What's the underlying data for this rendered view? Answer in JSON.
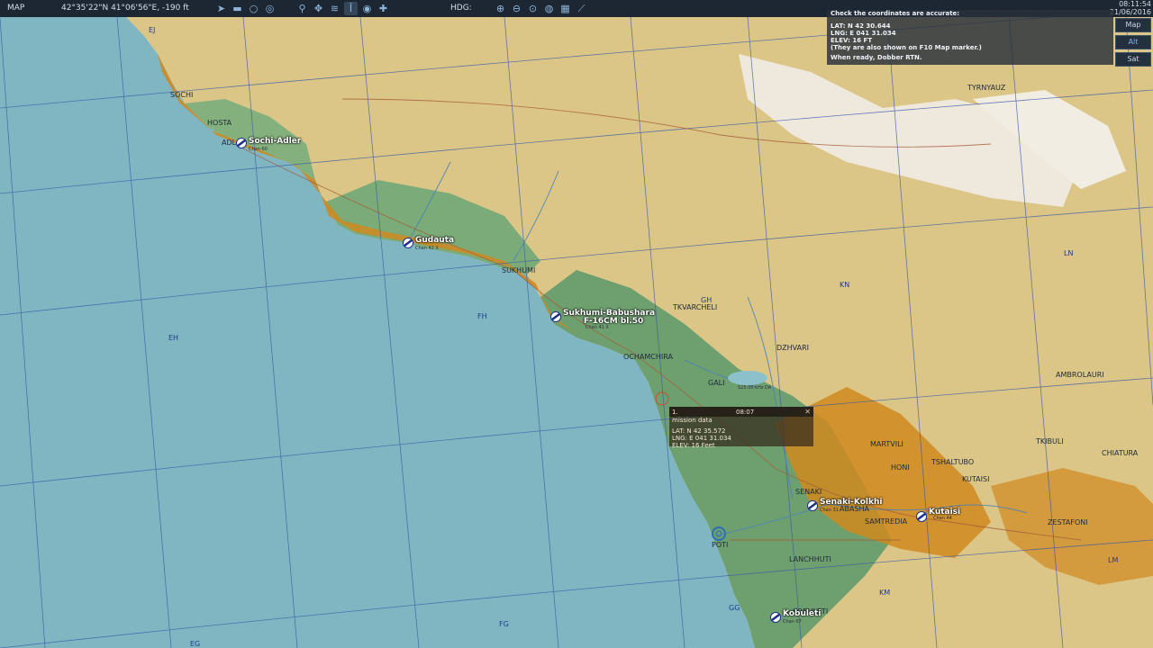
{
  "topbar": {
    "mode_label": "MAP",
    "cursor_readout": "42°35'22\"N 41°06'56\"E, -190 ft",
    "hdg_label": "HDG:",
    "clock_time": "08:11:54",
    "clock_date": "21/06/2016",
    "tool_icons": [
      "flight-plan-icon",
      "vehicle-icon",
      "circle-draw-icon",
      "chat-icon",
      "network-icon",
      "target-icon",
      "wireless-icon",
      "tower-icon",
      "comms-icon",
      "move-icon"
    ],
    "zoom_icons": [
      "zoom-in-icon",
      "zoom-out-icon",
      "zoom-fit-icon",
      "globe-icon",
      "grid-icon",
      "ruler-icon"
    ]
  },
  "message": {
    "title": "Check the coordinates are accurate:",
    "lines": [
      "LAT: N 42 30.644",
      "LNG: E 041 31.034",
      "ELEV: 16 FT",
      "(They are also shown on F10 Map marker.)",
      "When ready, Dobber RTN."
    ]
  },
  "layers": [
    "Map",
    "Alt",
    "Sat"
  ],
  "layer_selected": "Alt",
  "mission_marker": {
    "index": "1.",
    "time": "08:07",
    "title": "mission data",
    "lat": "LAT: N  42 35.572",
    "lng": "LNG: E 041 31.034",
    "elev": "ELEV: 16 Feet"
  },
  "airfields": [
    {
      "name": "Sochi-Adler",
      "sub": "Chan 60"
    },
    {
      "name": "Gudauta",
      "sub": "Chan 42 X"
    },
    {
      "name": "Sukhumi-Babushara",
      "sub": "Chan 41 X"
    },
    {
      "name": "Senaki-Kolkhi",
      "sub": "Chan 31"
    },
    {
      "name": "Kutaisi",
      "sub": "Chan 44"
    },
    {
      "name": "Kobuleti",
      "sub": "Chan 67"
    }
  ],
  "unit_label": "F-16CM bl.50",
  "navaid_label": "S25:00 kHz DA",
  "places": [
    "SOCHI",
    "HOSTA",
    "ADL",
    "SUKHUMI",
    "TKVARCHELI",
    "OCHAMCHIRA",
    "DZHVARI",
    "GALI",
    "TYRNYAUZ",
    "AMBROLAURI",
    "TKIBULI",
    "CHIATURA",
    "MARTVILI",
    "HONI",
    "TSHALTUBO",
    "KUTAISI",
    "SENAKI",
    "ABASHA",
    "SAMTREDIA",
    "ZESTAFONI",
    "POTI",
    "LANCHHUTI",
    "KOBULETI"
  ],
  "grid_squares": [
    "EJ",
    "EH",
    "FH",
    "GH",
    "KN",
    "LN",
    "FG",
    "GG",
    "KM",
    "LM",
    "EG"
  ],
  "colors": {
    "sea": "#7fb6c2",
    "lowland": "#6fa072",
    "hills": "#e2cc8e",
    "sand": "#d48a1e",
    "mountain": "#efeae2",
    "grid": "#3a5aa8",
    "river": "#4f84b8",
    "road": "#a65d3a"
  }
}
